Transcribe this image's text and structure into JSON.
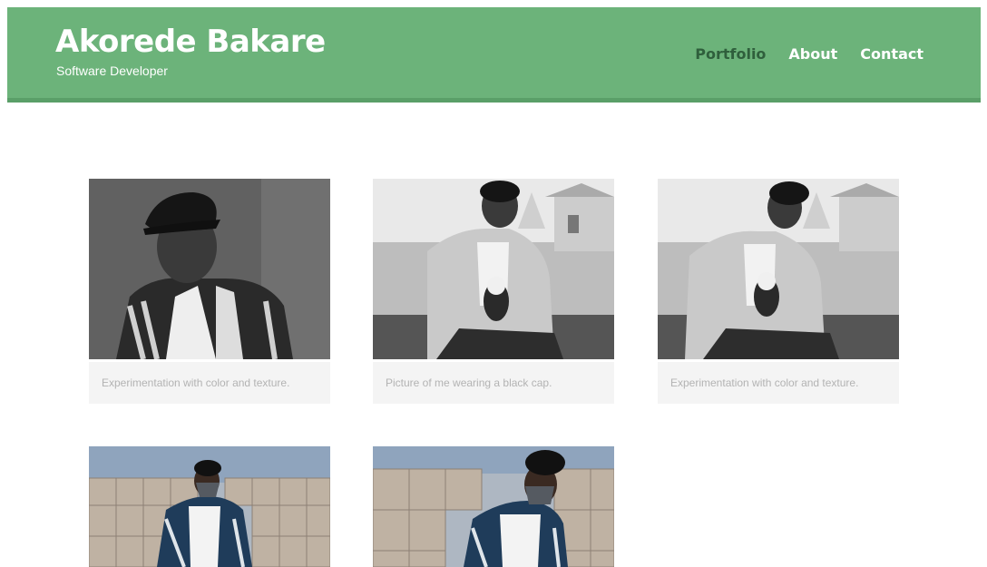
{
  "header": {
    "brand_name": "Akorede Bakare",
    "tagline": "Software Developer",
    "nav": [
      {
        "label": "Portfolio",
        "active": true
      },
      {
        "label": "About",
        "active": false
      },
      {
        "label": "Contact",
        "active": false
      }
    ]
  },
  "colors": {
    "header_bg": "#6cb37a",
    "active_nav": "#2f5f3c",
    "caption_bg": "#f4f4f4",
    "caption_text": "#b3b3b3"
  },
  "gallery": {
    "items": [
      {
        "image": "portrait-black-cap-bw",
        "caption": "Experimentation with color and texture."
      },
      {
        "image": "smiling-with-puppy-bw",
        "caption": "Picture of me wearing a black cap."
      },
      {
        "image": "looking-down-at-puppy-bw",
        "caption": "Experimentation with color and texture."
      },
      {
        "image": "masked-by-cement-blocks",
        "caption": ""
      },
      {
        "image": "masked-close-cement-blocks",
        "caption": ""
      }
    ]
  }
}
